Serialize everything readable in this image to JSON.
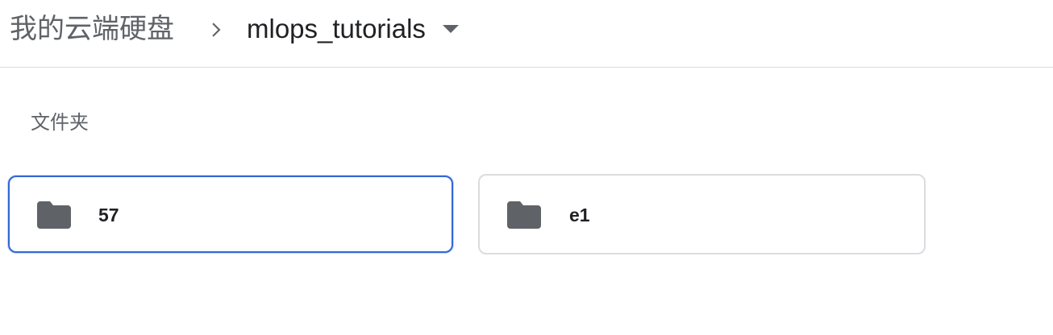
{
  "breadcrumb": {
    "root_label": "我的云端硬盘",
    "separator_icon": "chevron-right-icon",
    "current_label": "mlops_tutorials",
    "dropdown_icon": "caret-down-icon"
  },
  "section": {
    "title": "文件夹"
  },
  "folders": [
    {
      "name": "57",
      "icon": "folder-icon",
      "selected": true
    },
    {
      "name": "e1",
      "icon": "folder-icon",
      "selected": false
    }
  ],
  "colors": {
    "folder_icon": "#5f6368",
    "selection_border": "#3367d6",
    "tile_border": "#dadce0",
    "text_primary": "#202124",
    "text_secondary": "#5f6368"
  }
}
